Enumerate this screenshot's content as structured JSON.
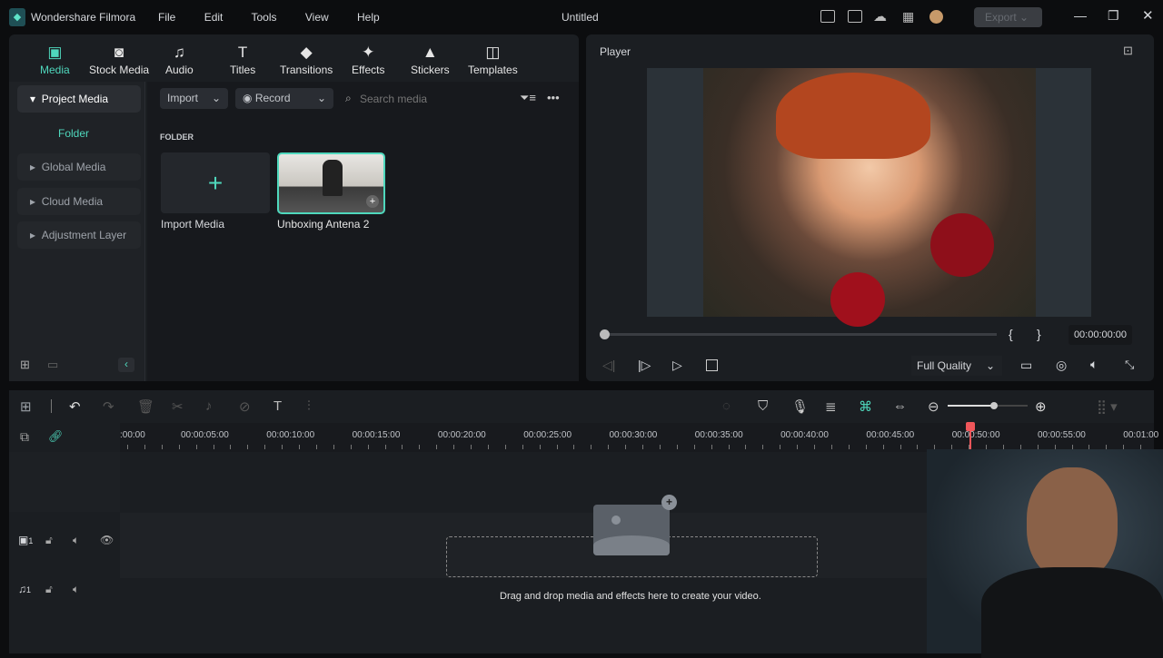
{
  "app": {
    "name": "Wondershare Filmora",
    "doc_title": "Untitled",
    "menu": [
      "File",
      "Edit",
      "Tools",
      "View",
      "Help"
    ],
    "export_label": "Export"
  },
  "tabs": [
    {
      "label": "Media",
      "icon": "media-icon"
    },
    {
      "label": "Stock Media",
      "icon": "stock-media-icon"
    },
    {
      "label": "Audio",
      "icon": "music-note-icon"
    },
    {
      "label": "Titles",
      "icon": "text-icon"
    },
    {
      "label": "Transitions",
      "icon": "transitions-icon"
    },
    {
      "label": "Effects",
      "icon": "effects-icon"
    },
    {
      "label": "Stickers",
      "icon": "stickers-icon"
    },
    {
      "label": "Templates",
      "icon": "templates-icon"
    }
  ],
  "sidebar": {
    "items": [
      "Project Media",
      "Folder",
      "Global Media",
      "Cloud Media",
      "Adjustment Layer"
    ]
  },
  "media": {
    "import_label": "Import",
    "record_label": "Record",
    "search_placeholder": "Search media",
    "folder_heading": "FOLDER",
    "items": [
      "Import Media",
      "Unboxing Antena 2"
    ]
  },
  "player": {
    "title": "Player",
    "timecode": "00:00:00:00",
    "quality": "Full Quality",
    "progress": 0
  },
  "timeline": {
    "ruler": [
      ":00:00",
      "00:00:05:00",
      "00:00:10:00",
      "00:00:15:00",
      "00:00:20:00",
      "00:00:25:00",
      "00:00:30:00",
      "00:00:35:00",
      "00:00:40:00",
      "00:00:45:00",
      "00:00:50:00",
      "00:00:55:00",
      "00:01:00"
    ],
    "video_track": "1",
    "audio_track": "1",
    "drop_hint": "Drag and drop media and effects here to create your video.",
    "zoom_level": 0.65
  },
  "colors": {
    "accent": "#4fd8bd",
    "playhead": "#f0565a"
  }
}
